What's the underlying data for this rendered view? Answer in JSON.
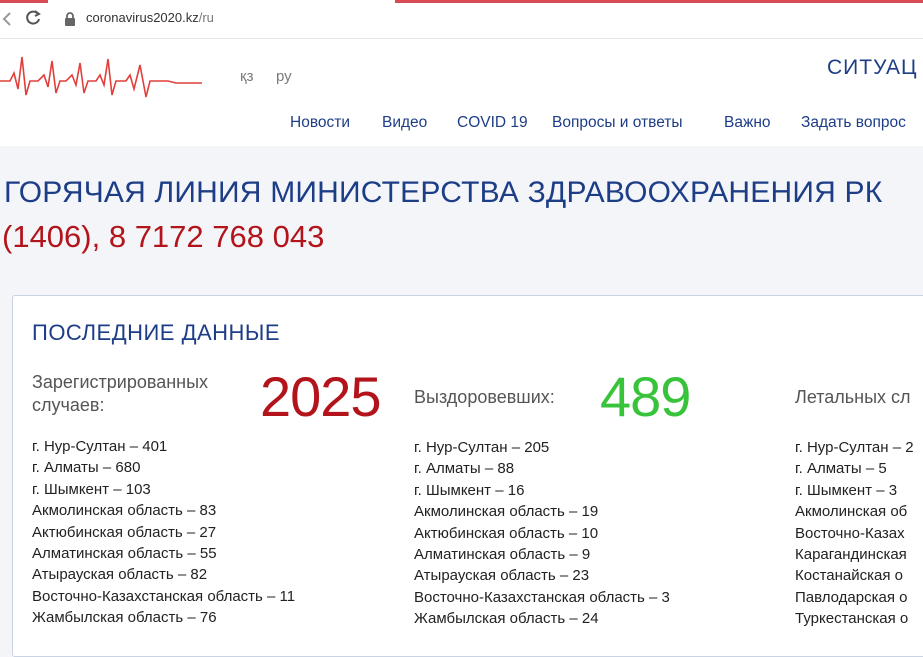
{
  "browser": {
    "url_host": "coronavirus2020.kz",
    "url_path": "/ru"
  },
  "header": {
    "lang_kz": "қз",
    "lang_ru": "ру",
    "situation": "СИТУАЦ",
    "nav": [
      "Новости",
      "Видео",
      "COVID 19",
      "Вопросы и ответы",
      "Важно",
      "Задать вопрос"
    ]
  },
  "hotline": {
    "title": "ГОРЯЧАЯ ЛИНИЯ МИНИСТЕРСТВА ЗДРАВООХРАНЕНИЯ РК",
    "phone": "(1406), 8 7172 768 043"
  },
  "stats": {
    "title": "ПОСЛЕДНИЕ ДАННЫЕ",
    "registered_label_1": "Зарегистрированных",
    "registered_label_2": "случаев:",
    "registered_value": "2025",
    "recovered_label": "Выздоровевших:",
    "recovered_value": "489",
    "deaths_label": "Летальных сл",
    "registered_list": [
      "г. Нур-Султан – 401",
      "г. Алматы – 680",
      "г. Шымкент – 103",
      "Акмолинская область – 83",
      "Актюбинская область – 27",
      "Алматинская область – 55",
      "Атырауская область – 82",
      "Восточно-Казахстанская область – 11",
      "Жамбылская область – 76"
    ],
    "recovered_list": [
      "г. Нур-Султан – 205",
      "г. Алматы – 88",
      "г. Шымкент – 16",
      "Акмолинская область – 19",
      "Актюбинская область – 10",
      "Алматинская область – 9",
      "Атырауская область – 23",
      "Восточно-Казахстанская область – 3",
      "Жамбылская область – 24"
    ],
    "deaths_list": [
      "г. Нур-Султан – 2",
      "г. Алматы – 5",
      "г. Шымкент – 3",
      "Акмолинская об",
      "Восточно-Казах",
      "Карагандинская",
      "Костанайская о",
      "Павлодарская о",
      "Туркестанская о"
    ]
  },
  "colors": {
    "brand_blue": "#1d3d86",
    "alert_red": "#b3141b",
    "recovered_green": "#37c43a"
  }
}
